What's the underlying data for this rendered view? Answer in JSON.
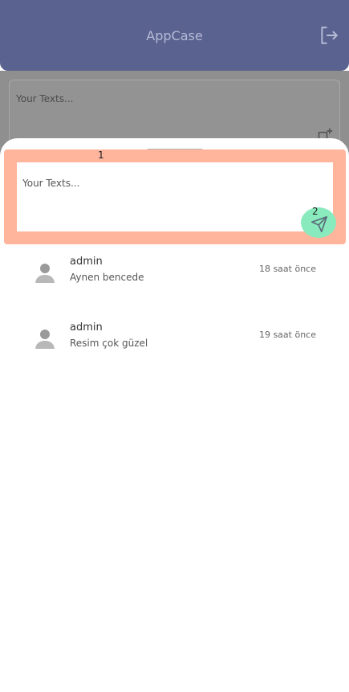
{
  "app": {
    "title": "AppCase",
    "logout_icon": "logout-icon"
  },
  "background_composer": {
    "placeholder": "Your Texts...",
    "add_icon": "add-image-icon"
  },
  "sheet": {
    "composer": {
      "placeholder": "Your Texts...",
      "send_icon": "send-icon"
    },
    "markers": {
      "one": "1",
      "two": "2"
    },
    "comments": [
      {
        "user": "admin",
        "text": "Aynen bencede",
        "time": "18 saat önce"
      },
      {
        "user": "admin",
        "text": "Resim çok güzel",
        "time": "19 saat önce"
      }
    ]
  },
  "colors": {
    "header_bg": "#5a6290",
    "overlay": "#8f8f8f",
    "highlight": "#ffb49c",
    "send_bg": "#89ebbd"
  }
}
